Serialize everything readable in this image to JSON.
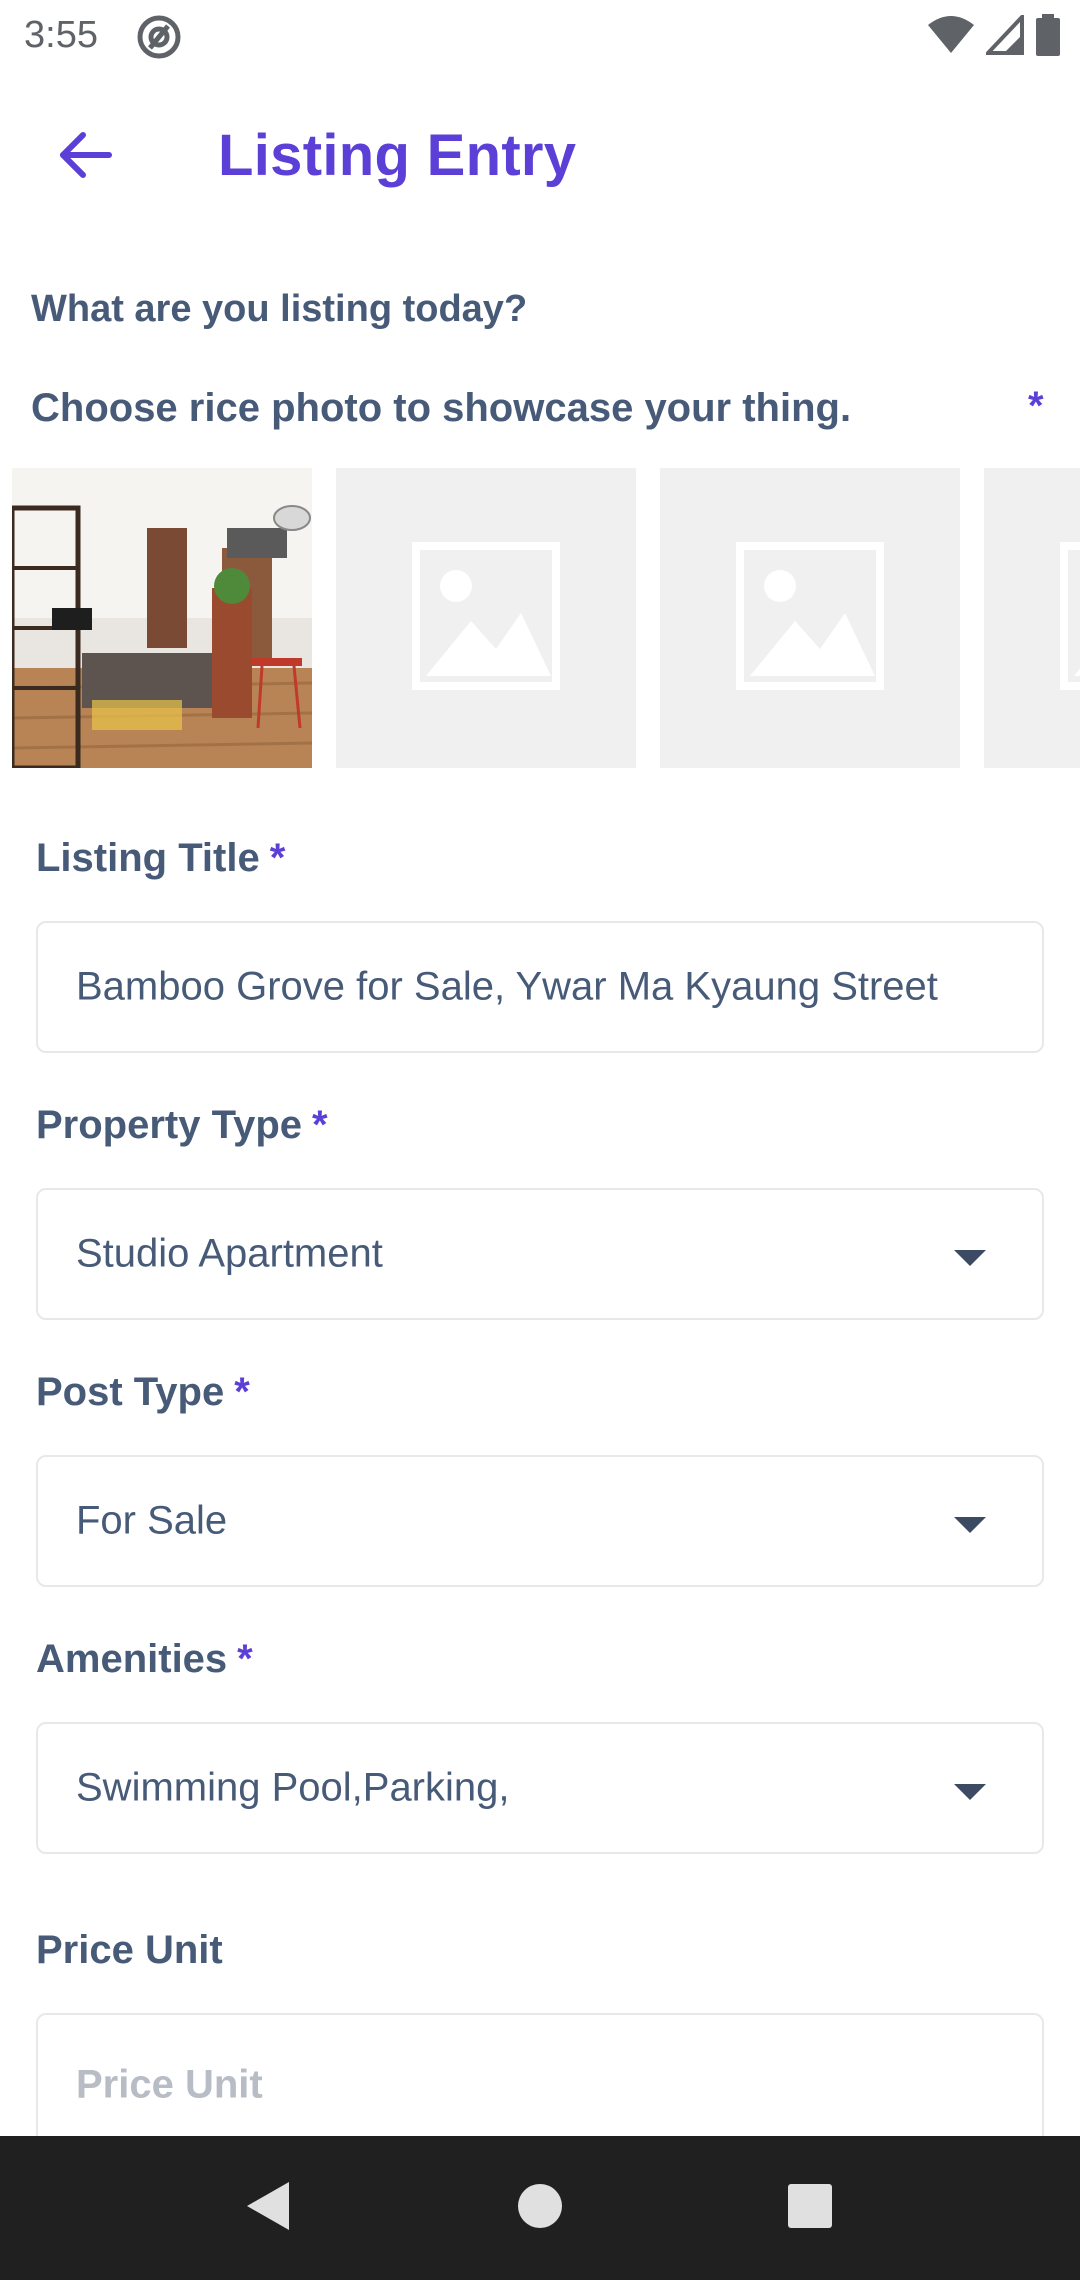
{
  "status_bar": {
    "time": "3:55"
  },
  "app_bar": {
    "title": "Listing Entry"
  },
  "intro": {
    "question": "What are you listing today?",
    "photo_prompt": "Choose rice photo to showcase your thing.",
    "required_marker": "*"
  },
  "photos": [
    {
      "state": "filled",
      "description": "room-photo"
    },
    {
      "state": "empty"
    },
    {
      "state": "empty"
    },
    {
      "state": "empty"
    }
  ],
  "form": {
    "listing_title": {
      "label": "Listing Title",
      "required": "*",
      "value": "Bamboo Grove for Sale, Ywar Ma Kyaung Street"
    },
    "property_type": {
      "label": "Property Type",
      "required": "*",
      "value": "Studio Apartment"
    },
    "post_type": {
      "label": "Post Type",
      "required": "*",
      "value": "For Sale"
    },
    "amenities": {
      "label": "Amenities",
      "required": "*",
      "value": "Swimming Pool,Parking,"
    },
    "price_unit": {
      "label": "Price Unit",
      "placeholder": "Price Unit"
    }
  },
  "colors": {
    "accent": "#5b3fd6",
    "label": "#475b78",
    "placeholder_bg": "#f0f0f0",
    "nav_bar": "#202020"
  },
  "icons": {
    "back": "arrow-left-icon",
    "at_sign": "at-sign-icon",
    "wifi": "wifi-icon",
    "signal": "signal-icon",
    "battery": "battery-icon",
    "image_placeholder": "image-placeholder-icon",
    "dropdown": "chevron-down-icon"
  }
}
